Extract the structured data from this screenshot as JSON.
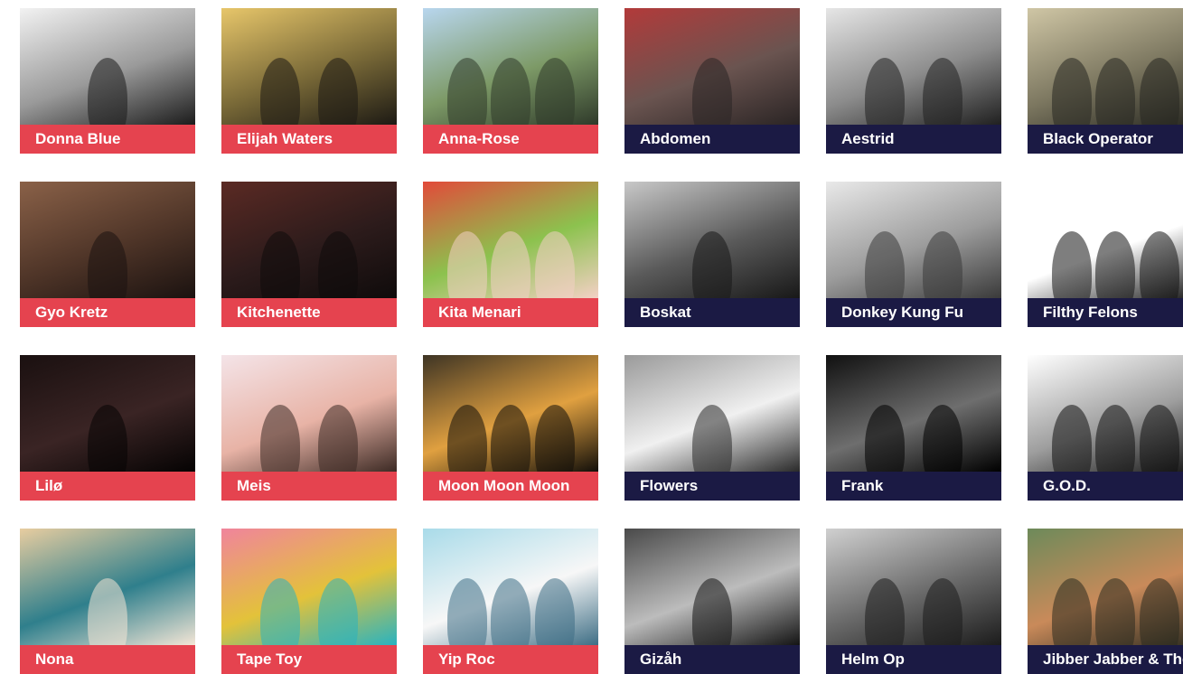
{
  "colors": {
    "red": "#e5434f",
    "navy": "#1b1a44"
  },
  "artists": [
    {
      "name": "Donna Blue",
      "label_style": "red",
      "tones": [
        "#f2f2f2",
        "#9a9a9a",
        "#1c1c1c"
      ]
    },
    {
      "name": "Elijah Waters",
      "label_style": "red",
      "tones": [
        "#e7c66a",
        "#7a6a38",
        "#1d1a14"
      ]
    },
    {
      "name": "Anna-Rose",
      "label_style": "red",
      "tones": [
        "#b8d6ee",
        "#7d9a67",
        "#2f3a2a"
      ]
    },
    {
      "name": "Abdomen",
      "label_style": "navy",
      "tones": [
        "#b23a3a",
        "#6a5450",
        "#2a2424"
      ]
    },
    {
      "name": "Aestrid",
      "label_style": "navy",
      "tones": [
        "#e6e6e6",
        "#8c8c8c",
        "#202020"
      ]
    },
    {
      "name": "Black Operator",
      "label_style": "navy",
      "tones": [
        "#cfc6a5",
        "#7c7760",
        "#262620"
      ]
    },
    {
      "name": "Gyo Kretz",
      "label_style": "red",
      "tones": [
        "#8a6148",
        "#4f3528",
        "#1b1210"
      ]
    },
    {
      "name": "Kitchenette",
      "label_style": "red",
      "tones": [
        "#5b2a24",
        "#2c1b1b",
        "#0f0b0b"
      ]
    },
    {
      "name": "Kita Menari",
      "label_style": "red",
      "tones": [
        "#e24a3a",
        "#8cc24e",
        "#f3d0c5"
      ]
    },
    {
      "name": "Boskat",
      "label_style": "navy",
      "tones": [
        "#c8c8c8",
        "#5a5a5a",
        "#181818"
      ]
    },
    {
      "name": "Donkey Kung Fu",
      "label_style": "navy",
      "tones": [
        "#e9e9e9",
        "#9c9c9c",
        "#3a3a3a"
      ]
    },
    {
      "name": "Filthy Felons",
      "label_style": "navy",
      "tones": [
        "#ffffff",
        "#ffffff",
        "#141414"
      ]
    },
    {
      "name": "Lilø",
      "label_style": "red",
      "tones": [
        "#1a1010",
        "#3a2424",
        "#050303"
      ]
    },
    {
      "name": "Meis",
      "label_style": "red",
      "tones": [
        "#f4e4e8",
        "#e8b3a6",
        "#3c2a24"
      ]
    },
    {
      "name": "Moon Moon Moon",
      "label_style": "red",
      "tones": [
        "#3e3424",
        "#e0a040",
        "#120f0a"
      ]
    },
    {
      "name": "Flowers",
      "label_style": "navy",
      "tones": [
        "#9a9a9a",
        "#f0f0f0",
        "#2a2a2a"
      ]
    },
    {
      "name": "Frank",
      "label_style": "navy",
      "tones": [
        "#101010",
        "#6e6e6e",
        "#000000"
      ]
    },
    {
      "name": "G.O.D.",
      "label_style": "navy",
      "tones": [
        "#ffffff",
        "#9e9e9e",
        "#111111"
      ]
    },
    {
      "name": "Nona",
      "label_style": "red",
      "tones": [
        "#e8cda0",
        "#2f7f8c",
        "#f4e6d6"
      ]
    },
    {
      "name": "Tape Toy",
      "label_style": "red",
      "tones": [
        "#f0849c",
        "#e3c23a",
        "#29b3c0"
      ]
    },
    {
      "name": "Yip Roc",
      "label_style": "red",
      "tones": [
        "#a9dbe9",
        "#f7f7f7",
        "#3e6e85"
      ]
    },
    {
      "name": "Gizåh",
      "label_style": "navy",
      "tones": [
        "#4a4a4a",
        "#bcbcbc",
        "#141414"
      ]
    },
    {
      "name": "Helm Op",
      "label_style": "navy",
      "tones": [
        "#d0d0d0",
        "#6a6a6a",
        "#1c1c1c"
      ]
    },
    {
      "name": "Jibber Jabber & The Jazzers",
      "label_style": "navy",
      "tones": [
        "#6d8a5a",
        "#c98a5a",
        "#2a2a1f"
      ]
    }
  ]
}
